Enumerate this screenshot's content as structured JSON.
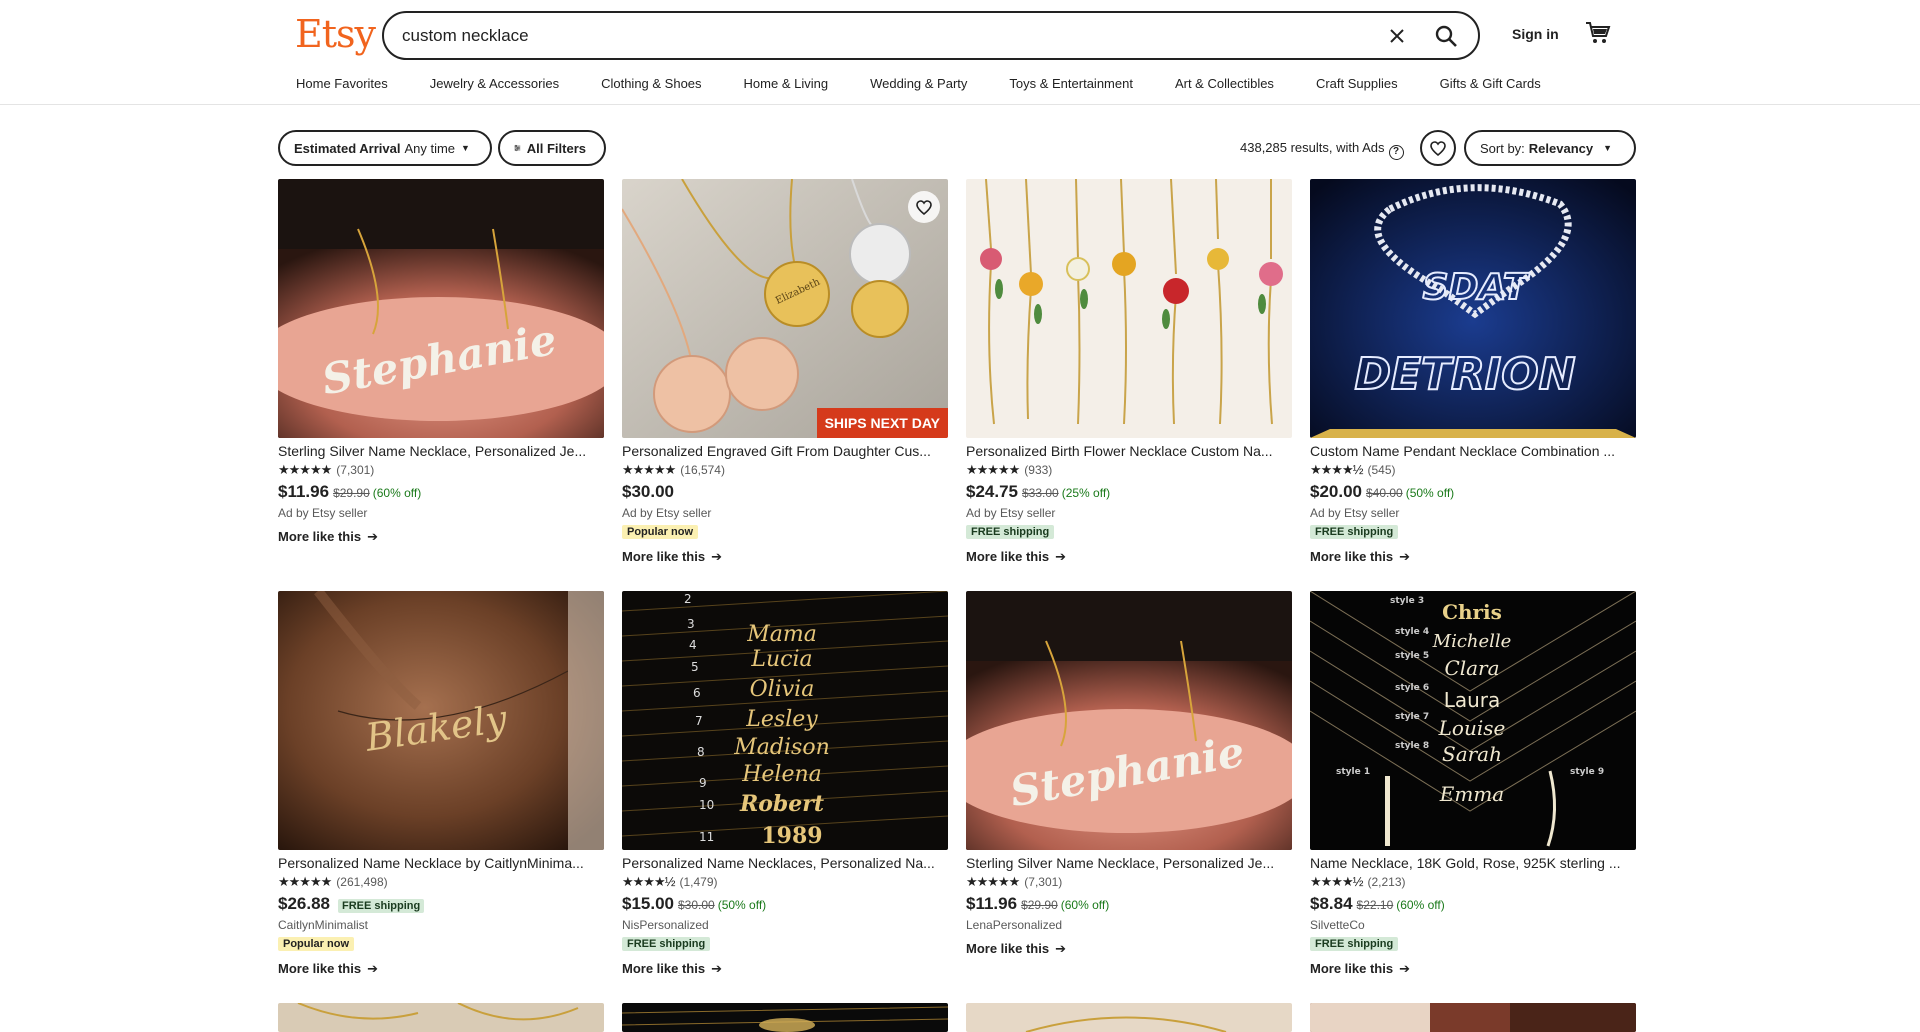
{
  "header": {
    "logo": "Etsy",
    "search_value": "custom necklace",
    "signin_label": "Sign in",
    "categories": [
      "Home Favorites",
      "Jewelry & Accessories",
      "Clothing & Shoes",
      "Home & Living",
      "Wedding & Party",
      "Toys & Entertainment",
      "Art & Collectibles",
      "Craft Supplies",
      "Gifts & Gift Cards"
    ]
  },
  "filters": {
    "arrival_label": "Estimated Arrival",
    "arrival_value": "Any time",
    "all_filters_label": "All Filters",
    "results_text": "438,285 results, with Ads",
    "sort_label": "Sort by:",
    "sort_value": "Relevancy"
  },
  "colors": {
    "brand": "#f1641e",
    "sale_green": "#1b7a1b",
    "ships_badge": "#d53a1b",
    "free_shipping_bg": "#d4e9d7",
    "popular_bg": "#fbf0b2"
  },
  "products": [
    {
      "title": "Sterling Silver Name Necklace, Personalized Je...",
      "stars": "★★★★★",
      "reviews": "(7,301)",
      "price": "$11.96",
      "original_price": "$29.90",
      "discount": "(60% off)",
      "seller": "Ad by Etsy seller",
      "more": "More like this",
      "image_text": "Stephanie"
    },
    {
      "title": "Personalized Engraved Gift From Daughter Cus...",
      "stars": "★★★★★",
      "reviews": "(16,574)",
      "price": "$30.00",
      "seller": "Ad by Etsy seller",
      "badge": "Popular now",
      "ships_badge": "SHIPS NEXT DAY",
      "more": "More like this",
      "image_text": "Elizabeth"
    },
    {
      "title": "Personalized Birth Flower Necklace Custom Na...",
      "stars": "★★★★★",
      "reviews": "(933)",
      "price": "$24.75",
      "original_price": "$33.00",
      "discount": "(25% off)",
      "seller": "Ad by Etsy seller",
      "badge": "FREE shipping",
      "more": "More like this"
    },
    {
      "title": "Custom Name Pendant Necklace Combination ...",
      "stars": "★★★★½",
      "reviews": "(545)",
      "price": "$20.00",
      "original_price": "$40.00",
      "discount": "(50% off)",
      "seller": "Ad by Etsy seller",
      "badge": "FREE shipping",
      "more": "More like this",
      "image_text_1": "SDAT",
      "image_text_2": "DETRION"
    },
    {
      "title": "Personalized Name Necklace by CaitlynMinima...",
      "stars": "★★★★★",
      "reviews": "(261,498)",
      "price": "$26.88",
      "inline_free": "FREE shipping",
      "seller": "CaitlynMinimalist",
      "badge": "Popular now",
      "more": "More like this",
      "image_text": "Blakely"
    },
    {
      "title": "Personalized Name Necklaces, Personalized Na...",
      "stars": "★★★★½",
      "reviews": "(1,479)",
      "price": "$15.00",
      "original_price": "$30.00",
      "discount": "(50% off)",
      "seller": "NisPersonalized",
      "badge": "FREE shipping",
      "more": "More like this",
      "image_lines": [
        "Mama",
        "Lucia",
        "Olivia",
        "Lesley",
        "Madison",
        "Helena",
        "Robert",
        "1989"
      ]
    },
    {
      "title": "Sterling Silver Name Necklace, Personalized Je...",
      "stars": "★★★★★",
      "reviews": "(7,301)",
      "price": "$11.96",
      "original_price": "$29.90",
      "discount": "(60% off)",
      "seller": "LenaPersonalized",
      "more": "More like this",
      "image_text": "Stephanie"
    },
    {
      "title": "Name Necklace, 18K Gold, Rose, 925K sterling ...",
      "stars": "★★★★½",
      "reviews": "(2,213)",
      "price": "$8.84",
      "original_price": "$22.10",
      "discount": "(60% off)",
      "seller": "SilvetteCo",
      "badge": "FREE shipping",
      "more": "More like this",
      "image_lines": [
        "Chris",
        "Michelle",
        "Clara",
        "Laura",
        "Louise",
        "Sarah",
        "Emma"
      ]
    }
  ]
}
